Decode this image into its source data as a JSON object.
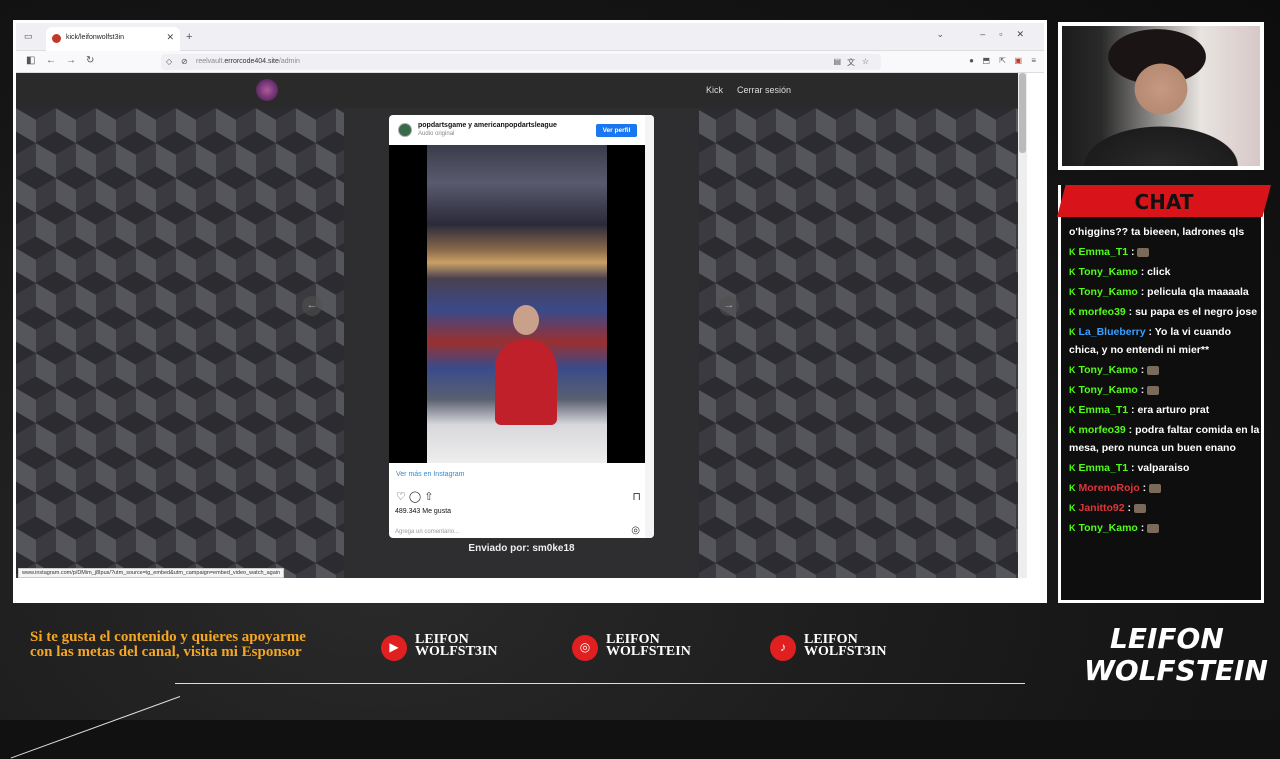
{
  "browser": {
    "tab_title": "kick/leifonwolfst3in",
    "new_tab": "+",
    "url_prefix": "reelvault.",
    "url_domain": "errorcode404.site",
    "url_path": "/admin"
  },
  "site": {
    "nav_kick": "Kick",
    "nav_logout": "Cerrar sesión",
    "sent_by": "Enviado por: sm0ke18",
    "status_url": "www.instagram.com/p/DMim_j8Ipus/?utm_source=ig_embed&utm_campaign=embed_video_watch_again"
  },
  "embed": {
    "account": "popdartsgame y americanpopdartsleague",
    "audio": "Audio original",
    "view_profile": "Ver perfil",
    "more_on_instagram": "Ver más en Instagram",
    "likes": "489.343 Me gusta",
    "comment_placeholder": "Agrega un comentario..."
  },
  "chat": {
    "title": "CHAT",
    "messages": [
      {
        "user": "",
        "text": "o'higgins?? ta bieeen, ladrones qls"
      },
      {
        "user": "Emma_T1",
        "text": " : "
      },
      {
        "user": "Tony_Kamo",
        "text": " : click"
      },
      {
        "user": "Tony_Kamo",
        "text": " : pelicula qla maaaala"
      },
      {
        "user": "morfeo39",
        "text": " : su papa es el negro jose"
      },
      {
        "user": "La_Blueberry",
        "text": " : Yo la vi cuando chica, y no entendi ni mier**"
      },
      {
        "user": "Tony_Kamo",
        "text": " : "
      },
      {
        "user": "Tony_Kamo",
        "text": " : "
      },
      {
        "user": "Emma_T1",
        "text": " : era arturo prat"
      },
      {
        "user": "morfeo39",
        "text": " : podra faltar comida en la mesa, pero nunca un buen enano"
      },
      {
        "user": "Emma_T1",
        "text": " : valparaiso"
      },
      {
        "user": "MorenoRojo",
        "text": " : "
      },
      {
        "user": "Janitto92",
        "text": " : "
      },
      {
        "user": "Tony_Kamo",
        "text": " : "
      }
    ]
  },
  "footer": {
    "sponsor_text": "Si te gusta el contenido y quieres apoyarme con las metas del canal, visita mi Esponsor",
    "youtube_line1": "LEIFON",
    "youtube_line2": "WOLFST3IN",
    "instagram_line1": "LEIFON",
    "instagram_line2": "WOLFSTEIN",
    "tiktok_line1": "LEIFON",
    "tiktok_line2": "WOLFST3IN",
    "brand_top": "LEIFON",
    "brand_bottom": "WOLFSTEIN"
  },
  "colors": {
    "accent": "#d8141a",
    "kick_green": "#53fc18",
    "sponsor": "#f5a623"
  }
}
